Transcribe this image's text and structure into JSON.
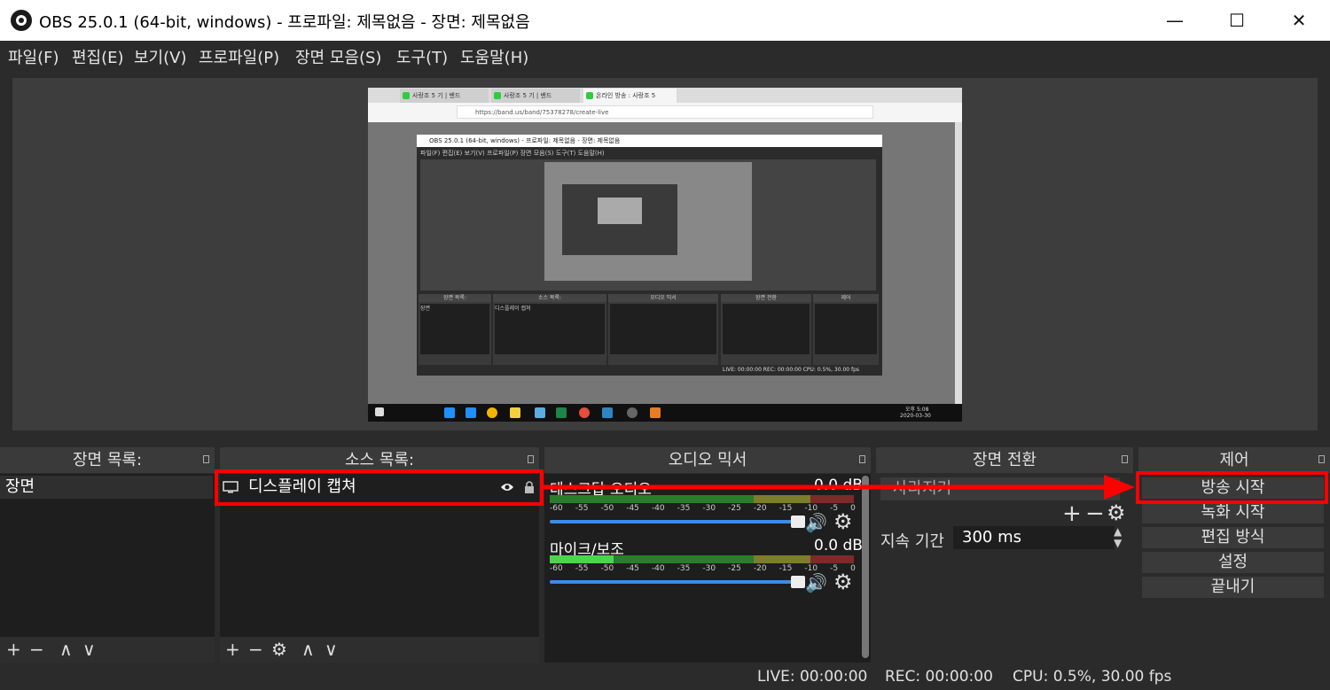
{
  "window": {
    "title": "OBS 25.0.1 (64-bit, windows) - 프로파일: 제목없음 - 장면: 제목없음",
    "minimize": "—",
    "maximize": "☐",
    "close": "✕"
  },
  "menu": [
    "파일(F)",
    "편집(E)",
    "보기(V)",
    "프로파일(P)",
    "장면 모음(S)",
    "도구(T)",
    "도움말(H)"
  ],
  "preview": {
    "tabs": [
      "사랑조 5 기 | 밴드",
      "사랑조 5 기 | 밴드",
      "온라인 방송 : 사랑조 5"
    ],
    "url": "https://band.us/band/75378278/create-live",
    "obs_title": "OBS 25.0.1 (64-bit, windows) - 프로파일: 제목없음 - 장면: 제목없음",
    "obs_menu": "파일(F)  편집(E)  보기(V)  프로파일(P)  장면 모음(S)  도구(T)  도움말(H)",
    "mini_docks": [
      "장면 목록:",
      "소스 목록:",
      "오디오 믹서",
      "장면 전환",
      "제어"
    ],
    "mini_scene": "장면",
    "mini_source": "디스플레이 캡쳐",
    "mini_status": "LIVE: 00:00:00   REC: 00:00:00   CPU: 0.5%, 30.00 fps",
    "taskbar_time": "오후 5:08",
    "taskbar_date": "2020-03-30"
  },
  "scenes": {
    "header": "장면 목록:",
    "items": [
      "장면"
    ],
    "footer": [
      "+",
      "−",
      "∧",
      "∨"
    ]
  },
  "sources": {
    "header": "소스 목록:",
    "items": [
      {
        "label": "디스플레이 캡쳐",
        "icon": "monitor-icon"
      }
    ],
    "footer": [
      "+",
      "−",
      "⚙",
      "∧",
      "∨"
    ]
  },
  "mixer": {
    "header": "오디오 믹서",
    "ticks": [
      "-60",
      "-55",
      "-50",
      "-45",
      "-40",
      "-35",
      "-30",
      "-25",
      "-20",
      "-15",
      "-10",
      "-5",
      "0"
    ],
    "channels": [
      {
        "name": "데스크탑 오디오",
        "db": "0.0 dB"
      },
      {
        "name": "마이크/보조",
        "db": "0.0 dB"
      }
    ]
  },
  "transitions": {
    "header": "장면 전환",
    "selected": "사라지기",
    "duration_label": "지속 기간",
    "duration_value": "300 ms",
    "buttons": [
      "+",
      "−",
      "⚙"
    ]
  },
  "controls": {
    "header": "제어",
    "buttons": [
      "방송 시작",
      "녹화 시작",
      "편집 방식",
      "설정",
      "끝내기"
    ]
  },
  "status": {
    "live": "LIVE: 00:00:00",
    "rec": "REC: 00:00:00",
    "cpu": "CPU: 0.5%, 30.00 fps"
  },
  "colors": {
    "highlight": "#ff0000",
    "accent": "#3c8ce7"
  }
}
